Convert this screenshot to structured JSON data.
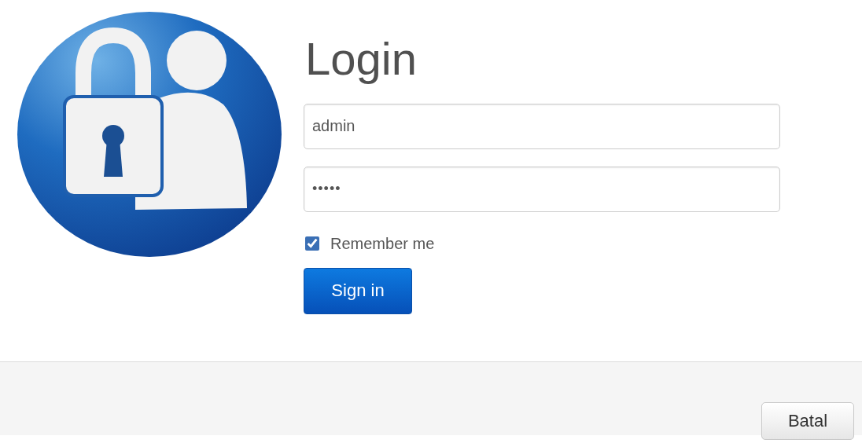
{
  "title": "Login",
  "fields": [
    {
      "kind": "text",
      "value": "admin"
    },
    {
      "kind": "password",
      "value": "•••••"
    }
  ],
  "remember": {
    "label": "Remember me",
    "checked": true
  },
  "submit": "Sign in",
  "footer": {
    "button": "Batal"
  }
}
